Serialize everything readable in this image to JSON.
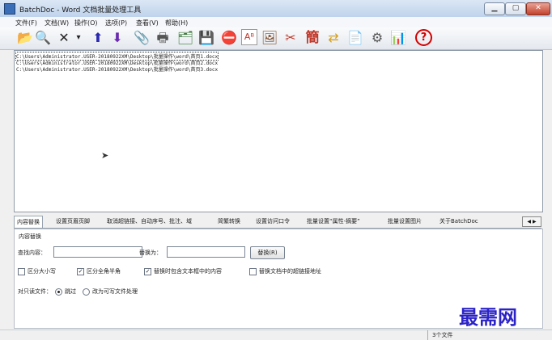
{
  "window": {
    "title": "BatchDoc - Word 文档批量处理工具",
    "minimize": "▁",
    "maximize": "▢",
    "close": "✕"
  },
  "menu": [
    "文件(F)",
    "文档(W)",
    "操作(O)",
    "选项(P)",
    "查看(V)",
    "帮助(H)"
  ],
  "toolbar": [
    {
      "name": "add-files-icon",
      "glyph": "📂",
      "color": "#3456a0"
    },
    {
      "name": "add-folder-icon",
      "glyph": "🔍",
      "color": "#3456a0"
    },
    {
      "name": "delete-icon",
      "glyph": "✕",
      "color": "#222222"
    },
    {
      "name": "dropdown-icon",
      "glyph": "▾",
      "color": "#222222"
    },
    {
      "name": "move-up-icon",
      "glyph": "⬆",
      "color": "#2a2ab0"
    },
    {
      "name": "move-down-icon",
      "glyph": "⬇",
      "color": "#6b2ab0"
    },
    {
      "name": "attach-icon",
      "glyph": "📎",
      "color": "#333333"
    },
    {
      "name": "print-icon",
      "glyph": "🖶",
      "color": "#555555"
    },
    {
      "name": "tree-icon",
      "glyph": "🗂",
      "color": "#3a7a3a"
    },
    {
      "name": "save-icon",
      "glyph": "💾",
      "color": "#2d4d7a"
    },
    {
      "name": "remove-doc-icon",
      "glyph": "⛔",
      "color": "#c0392b"
    },
    {
      "name": "font-icon",
      "glyph": "Aᴮ",
      "color": "#c0392b"
    },
    {
      "name": "picture-icon",
      "glyph": "🖼",
      "color": "#7a4a2a"
    },
    {
      "name": "tools-icon",
      "glyph": "✂",
      "color": "#c0392b"
    },
    {
      "name": "simplified-traditional-icon",
      "glyph": "簡",
      "color": "#c0392b"
    },
    {
      "name": "convert-icon",
      "glyph": "⇄",
      "color": "#d4a020"
    },
    {
      "name": "document-icon",
      "glyph": "📄",
      "color": "#b08800"
    },
    {
      "name": "settings-icon",
      "glyph": "⚙",
      "color": "#555555"
    },
    {
      "name": "stats-icon",
      "glyph": "📊",
      "color": "#c0392b"
    },
    {
      "name": "help-icon",
      "glyph": "?",
      "color": "#d40000"
    }
  ],
  "files": [
    "C:\\Users\\Administrator.USER-20180922XM\\Desktop\\批量操作\\word\\首页1.docx",
    "C:\\Users\\Administrator.USER-20180922XM\\Desktop\\批量操作\\word\\首页2.docx",
    "C:\\Users\\Administrator.USER-20180922XM\\Desktop\\批量操作\\word\\首页3.docx"
  ],
  "tabs": [
    "内容替换",
    "设置页眉页脚",
    "取消超链接、自动序号、批注、域",
    "简繁转换",
    "设置访问口令",
    "批量设置“属性-摘要”",
    "批量设置图片",
    "关于BatchDoc"
  ],
  "tab_scroll": "◀ ▶",
  "panel": {
    "group_title": "内容替换",
    "find_label": "查找内容：",
    "find_value": "",
    "replace_label": "替换为：",
    "replace_value": "",
    "replace_button": "替换(R)",
    "opt_case": "区分大小写",
    "opt_width": "区分全角半角",
    "opt_textbox": "替换时包含文本框中的内容",
    "opt_hyperlink": "替换文档中的超链接地址",
    "readonly_label": "对只读文件：",
    "radio_skip": "跳过",
    "radio_writable": "改为可写文件处理"
  },
  "status": {
    "count": "3个文件"
  },
  "watermark": "最需网"
}
